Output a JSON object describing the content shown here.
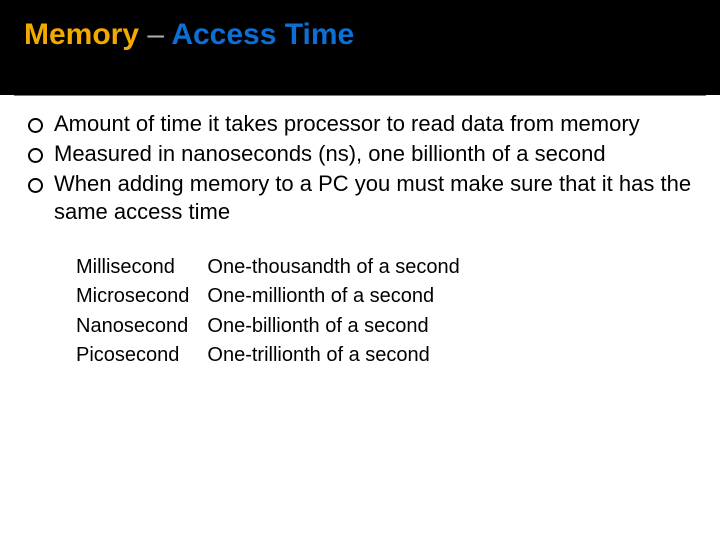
{
  "title": {
    "part1": "Memory",
    "dash": "–",
    "part2": "Access Time"
  },
  "bullets": [
    "Amount of time it takes processor to read data from memory",
    "Measured in nanoseconds (ns), one billionth of a second",
    "When adding memory to a PC you must make sure that it has the same access time"
  ],
  "units": [
    {
      "name": "Millisecond",
      "def": "One-thousandth of a second"
    },
    {
      "name": "Microsecond",
      "def": "One-millionth of a second"
    },
    {
      "name": "Nanosecond",
      "def": "One-billionth of a second"
    },
    {
      "name": "Picosecond",
      "def": "One-trillionth of a second"
    }
  ]
}
